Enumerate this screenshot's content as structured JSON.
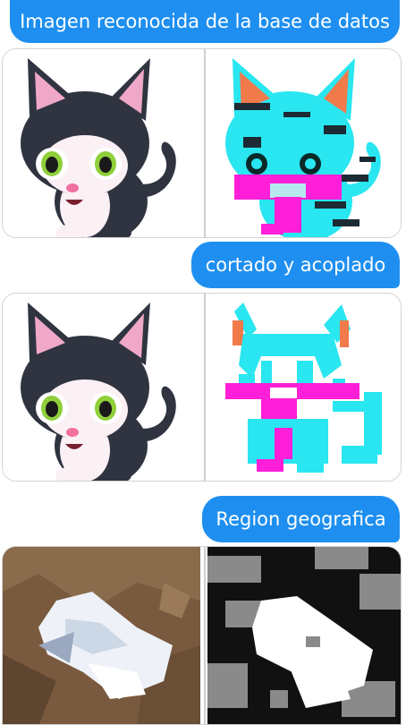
{
  "messages": [
    {
      "text": "Imagen reconocida de la base de datos"
    },
    {
      "text": "cortado y acoplado"
    },
    {
      "text": "Region geografica"
    }
  ],
  "colors": {
    "bubble": "#1e8ff0",
    "cat_dark": "#2f3440",
    "cat_pink": "#f0a8c8",
    "seg_cyan": "#29e6f0",
    "seg_magenta": "#ff1fd8",
    "seg_orange": "#f07a4a",
    "terrain_brown": "#7a5a3e",
    "snow": "#eef2f8"
  },
  "images": [
    {
      "name": "cat-original",
      "icon": "cat-illustration"
    },
    {
      "name": "cat-segmented",
      "icon": "cat-segmentation-map"
    },
    {
      "name": "cat-original-cropped",
      "icon": "cat-illustration"
    },
    {
      "name": "cat-segmented-cropped",
      "icon": "cat-segmentation-map"
    },
    {
      "name": "terrain-satellite",
      "icon": "satellite-terrain"
    },
    {
      "name": "terrain-mask",
      "icon": "binary-mask"
    }
  ]
}
